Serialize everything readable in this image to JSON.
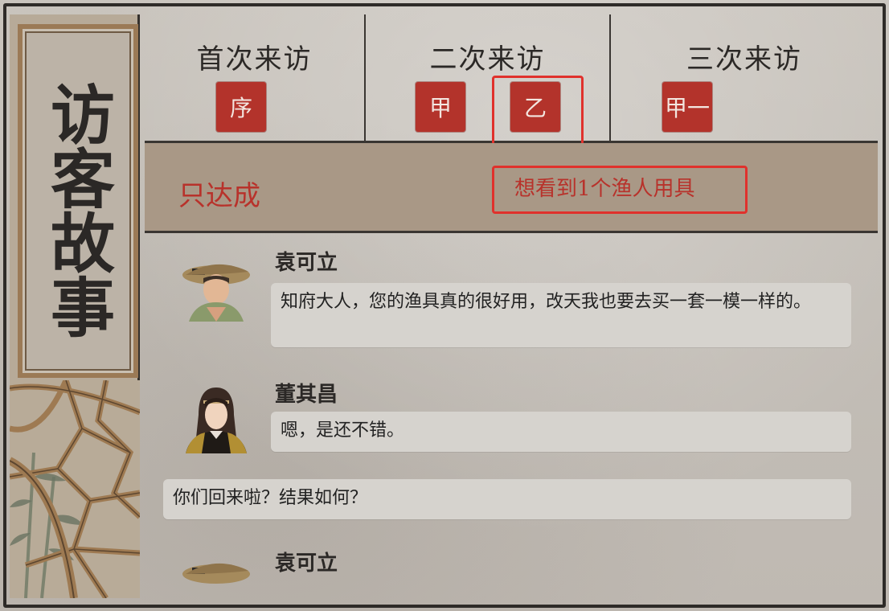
{
  "title": "访客故事",
  "visits": [
    {
      "title": "首次来访",
      "seals": [
        "序"
      ]
    },
    {
      "title": "二次来访",
      "seals": [
        "甲",
        "乙"
      ]
    },
    {
      "title": "三次来访",
      "seals": [
        "甲一"
      ]
    }
  ],
  "condition": {
    "label": "只达成",
    "requirement": "想看到1个渔人用具"
  },
  "dialog": [
    {
      "speaker": "袁可立",
      "text": "知府大人，您的渔具真的很好用，改天我也要去买一套一模一样的。",
      "avatar": "fisherman-portrait-icon"
    },
    {
      "speaker": "董其昌",
      "text": "嗯，是还不错。",
      "avatar": "scholar-portrait-icon"
    },
    {
      "speaker": "",
      "text": "你们回来啦？结果如何？",
      "avatar": ""
    },
    {
      "speaker": "袁可立",
      "text": "",
      "avatar": "fisherman-portrait-icon"
    }
  ],
  "colors": {
    "seal_red": "#b3332b",
    "highlight_red": "#e0312c",
    "condition_text": "#b8322b",
    "band": "#a99886"
  }
}
